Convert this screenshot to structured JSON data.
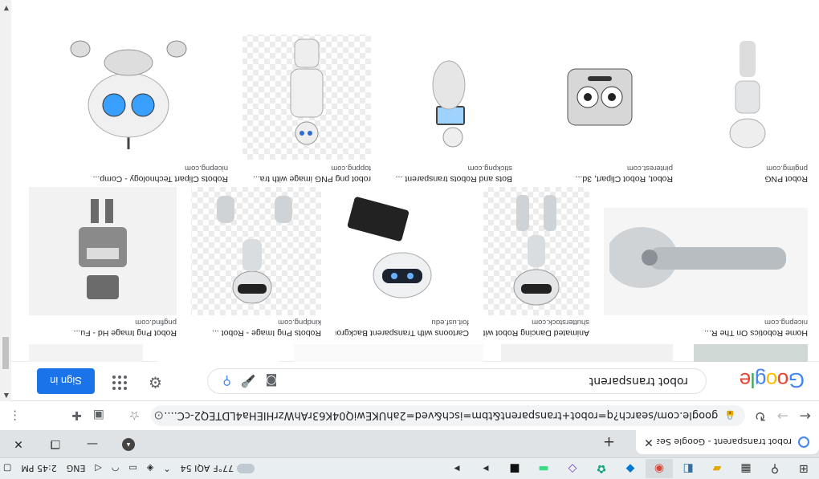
{
  "taskbar": {
    "time": "2:45 PM",
    "lang": "ENG",
    "weather_temp": "77°F",
    "aqi": "AQI 54",
    "apps": [
      "windows-icon",
      "search-icon",
      "task-view-icon",
      "file-explorer-icon",
      "python-icon",
      "chrome-icon",
      "vscode-icon",
      "chatgpt-icon",
      "visual-studio-icon",
      "android-studio-icon",
      "terminal-icon",
      "vscode2-icon",
      "vscode3-icon"
    ]
  },
  "browser": {
    "tab_title": "robot transparent - Google Sear",
    "url": "google.com/search?q=robot+transparent&tbm=isch&ved=2ahUKEwiQ04K63rAhWzrHIEHa4LDTEQ2-cC...."
  },
  "google": {
    "logo": "Google",
    "query": "robot transparent",
    "signin_label": "Sign in"
  },
  "results": {
    "row1": [
      {
        "caption": "Home Robotics On The R...",
        "source": "nicepng.com"
      },
      {
        "caption": "Animated Dancing Robot with Alpha Stock...",
        "source": "shutterstock.com"
      },
      {
        "caption": "Cartoons with Transparent Backgrounds | TIM",
        "source": "foit.usf.edu"
      },
      {
        "caption": "Robots Png Image - Robot ...",
        "source": "kindpng.com"
      },
      {
        "caption": "Robot Png Image Hd - Fu...",
        "source": "pngfind.com"
      }
    ],
    "row2": [
      {
        "caption": "Robot PNG",
        "source": "pngimg.com"
      },
      {
        "caption": "Robot, Robot Clipart, 3d...",
        "source": "pinterest.com"
      },
      {
        "caption": "Bots and Robots transparent ...",
        "source": "stickpng.com"
      },
      {
        "caption": "robot png PNG image with tra...",
        "source": "toppng.com"
      },
      {
        "caption": "Robots Clipart Technology - Comp...",
        "source": "nicepng.com"
      }
    ]
  }
}
